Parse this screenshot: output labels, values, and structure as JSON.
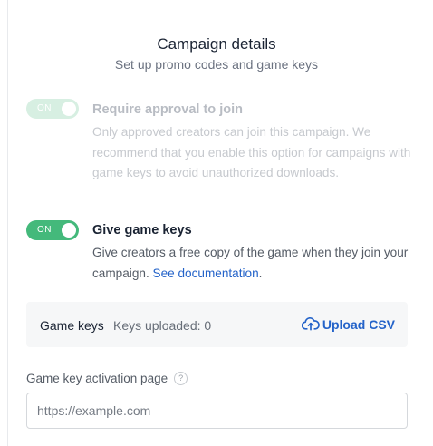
{
  "header": {
    "title": "Campaign details",
    "subtitle": "Set up promo codes and game keys"
  },
  "approval": {
    "toggle_label": "ON",
    "enabled": true,
    "disabled_state": true,
    "title": "Require approval to join",
    "description": "Only approved creators can join this campaign. We recommend that you enable this option for campaigns with game keys to avoid unauthorized downloads."
  },
  "game_keys": {
    "toggle_label": "ON",
    "enabled": true,
    "title": "Give game keys",
    "description": "Give creators a free copy of the game when they join your campaign.",
    "link_text": "See documentation",
    "link_suffix": "."
  },
  "keys_panel": {
    "label": "Game keys",
    "count_text": "Keys uploaded: 0",
    "upload_label": "Upload CSV",
    "upload_icon": "cloud-upload-icon"
  },
  "activation": {
    "label": "Game key activation page",
    "help_glyph": "?",
    "placeholder": "https://example.com",
    "value": ""
  },
  "colors": {
    "toggle_on": "#44b97b",
    "toggle_disabled": "#d7efe2",
    "link": "#2463c9",
    "title": "#1a2333"
  }
}
